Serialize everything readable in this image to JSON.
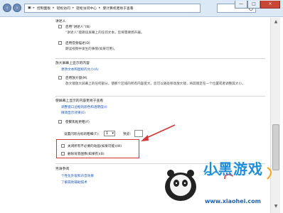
{
  "window": {
    "breadcrumb": [
      "控制面板",
      "轻松访问",
      "轻松访问中心",
      "使计算机更易于查看"
    ],
    "controls": [
      "—",
      "□",
      "×"
    ]
  },
  "top_section": {
    "title": "讲述人",
    "options": [
      {
        "label": "启用“讲述人”(N)",
        "checked": false,
        "desc": "“讲述人”能朗读屏幕上的任何文本。您将需要扬声器。"
      },
      {
        "label": "启用音频描述(D)",
        "checked": false,
        "desc": "朗读视频中发生的事情(如果可用)。"
      }
    ]
  },
  "zoom": {
    "title": "放大屏幕上显示的内容",
    "link": "更改文本和图标的大小(A)",
    "option_label": "启用放大镜(M)",
    "desc": "放大镜放大屏幕上的任何部分，使那个区域的所有内容变大。您可以随处移动放大镜，将其锁定在一个位置或者调整其大小。"
  },
  "easier": {
    "title": "使屏幕上显示的内容更易于查看",
    "links": [
      "调整窗口边框的颜色和透明度(I)",
      "微调显示效果(E)"
    ],
    "cursor_label": "使聚焦框更粗(F)",
    "thickness_label": "设置闪烁光标的粗细(T)：",
    "thickness_value": "1",
    "preview_label": "预览：",
    "animations_label": "关闭所有不必要的动画(如果可能)(W)",
    "background_label": "删除背景图像(如果有)(B)"
  },
  "see_also": {
    "title": "另请参阅",
    "links": [
      "个性化外观和声音效果",
      "了解其他辅助技术"
    ]
  },
  "watermark": {
    "brand": "小黑游戏",
    "url": "www.xiaohei.com"
  }
}
